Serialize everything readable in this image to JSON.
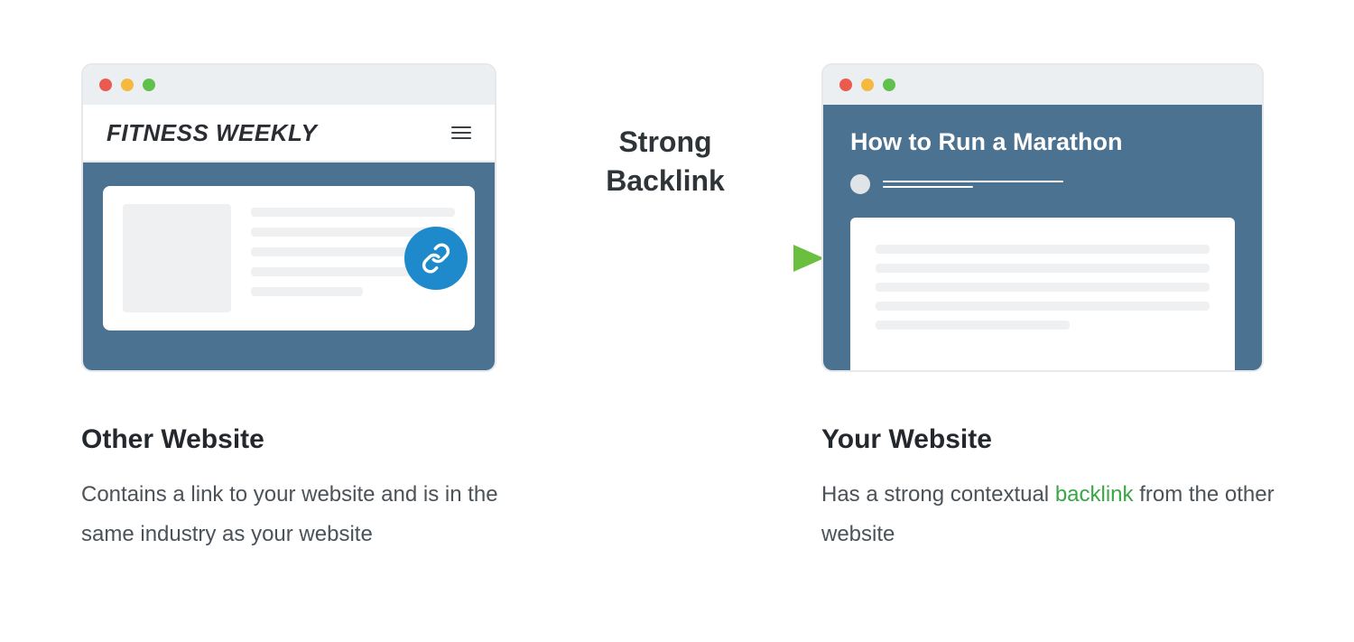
{
  "arrow_label_line1": "Strong",
  "arrow_label_line2": "Backlink",
  "left": {
    "site_title": "FITNESS WEEKLY",
    "caption_title": "Other Website",
    "caption_body": "Contains a link to your website and is in the same industry as your website"
  },
  "right": {
    "article_title": "How to Run a Marathon",
    "caption_title": "Your Website",
    "caption_prefix": "Has a strong contextual ",
    "caption_highlight": "backlink",
    "caption_suffix": " from the other website"
  },
  "colors": {
    "brand_blue": "#4c7291",
    "link_badge": "#1e8acb",
    "highlight_green": "#3aa646"
  }
}
